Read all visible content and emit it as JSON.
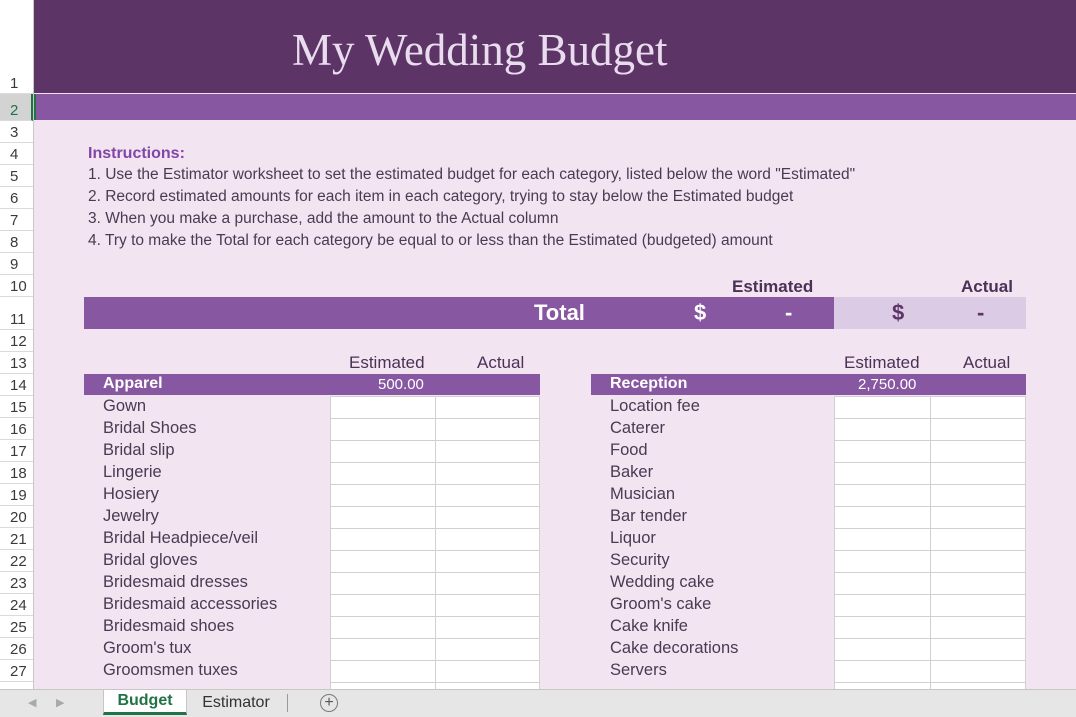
{
  "title": "My Wedding Budget",
  "row_numbers": [
    "1",
    "2",
    "3",
    "4",
    "5",
    "6",
    "7",
    "8",
    "9",
    "10",
    "11",
    "12",
    "13",
    "14",
    "15",
    "16",
    "17",
    "18",
    "19",
    "20",
    "21",
    "22",
    "23",
    "24",
    "25",
    "26",
    "27"
  ],
  "instructions": {
    "heading": "Instructions:",
    "lines": [
      "1. Use the Estimator worksheet to set the estimated budget for each category, listed below the word \"Estimated\"",
      "2. Record estimated amounts for each item in each category, trying to stay below the Estimated budget",
      "3. When you make a purchase, add the amount to the Actual column",
      "4. Try to make the Total for each category be equal to or less than the Estimated (budgeted) amount"
    ]
  },
  "totals": {
    "estimated_label": "Estimated",
    "actual_label": "Actual",
    "total_label": "Total",
    "est_currency": "$",
    "est_value": "-",
    "act_currency": "$",
    "act_value": "-"
  },
  "apparel": {
    "col_estimated": "Estimated",
    "col_actual": "Actual",
    "name": "Apparel",
    "estimated": "500.00",
    "items": [
      "Gown",
      "Bridal Shoes",
      "Bridal slip",
      "Lingerie",
      "Hosiery",
      "Jewelry",
      "Bridal Headpiece/veil",
      "Bridal gloves",
      "Bridesmaid dresses",
      "Bridesmaid accessories",
      "Bridesmaid shoes",
      "Groom's tux",
      "Groomsmen tuxes"
    ]
  },
  "reception": {
    "col_estimated": "Estimated",
    "col_actual": "Actual",
    "name": "Reception",
    "estimated": "2,750.00",
    "items": [
      "Location fee",
      "Caterer",
      "Food",
      "Baker",
      "Musician",
      "Bar tender",
      "Liquor",
      "Security",
      "Wedding cake",
      "Groom's cake",
      "Cake knife",
      "Cake decorations",
      "Servers"
    ]
  },
  "tabs": {
    "active": "Budget",
    "other": "Estimator",
    "add": "+"
  },
  "colors": {
    "title_bg": "#5c3566",
    "band": "#8757a2",
    "sheet_bg": "#f3e4f1",
    "accent_green": "#217346"
  }
}
